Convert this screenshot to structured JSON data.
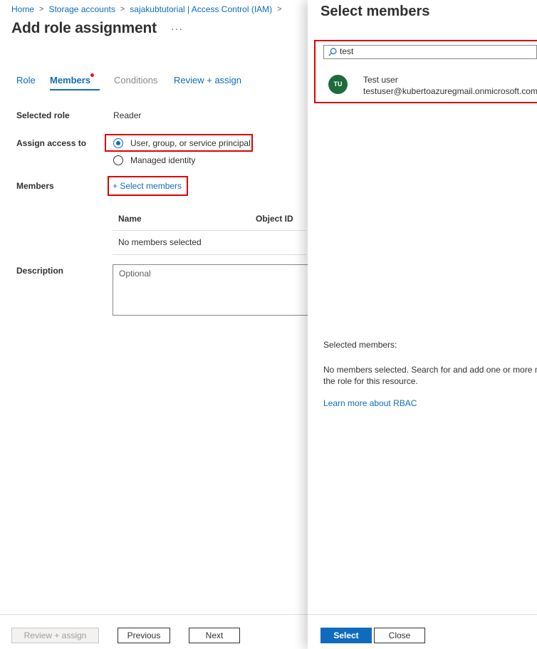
{
  "breadcrumb": [
    "Home",
    "Storage accounts",
    "sajakubtutorial | Access Control (IAM)"
  ],
  "page": {
    "title": "Add role assignment",
    "more_label": "···"
  },
  "tabs": {
    "role": "Role",
    "members": "Members",
    "conditions": "Conditions",
    "review": "Review + assign"
  },
  "form": {
    "selected_role_label": "Selected role",
    "selected_role_value": "Reader",
    "assign_access_label": "Assign access to",
    "assign_options": [
      "User, group, or service principal",
      "Managed identity"
    ],
    "assign_selected_index": 0,
    "members_label": "Members",
    "select_members_link": "+ Select members",
    "table_headers": [
      "Name",
      "Object ID"
    ],
    "table_empty": "No members selected",
    "description_label": "Description",
    "description_placeholder": "Optional"
  },
  "footer": {
    "review_button": "Review + assign",
    "previous_button": "Previous",
    "next_button": "Next"
  },
  "panel": {
    "title": "Select members",
    "search_value": "test",
    "results": [
      {
        "initials": "TU",
        "name": "Test user",
        "email": "testuser@kubertoazuregmail.onmicrosoft.com",
        "avatar_color": "#1e6b3c"
      }
    ],
    "selected_members_label": "Selected members:",
    "no_members_text_line1": "No members selected. Search for and add one or more me",
    "no_members_text_line2": "the role for this resource.",
    "learn_more_link": "Learn more about RBAC",
    "select_button": "Select",
    "close_button": "Close"
  },
  "colors": {
    "accent": "#0f6cbd",
    "highlight_box": "#e00000",
    "avatar": "#1e6b3c"
  }
}
